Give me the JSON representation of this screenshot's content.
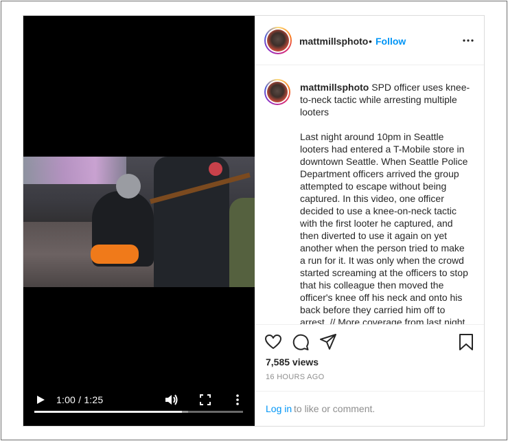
{
  "video": {
    "time_display": "1:00 / 1:25",
    "progress_fraction": 0.706,
    "buffered_fraction": 0.737
  },
  "header": {
    "username": "mattmillsphoto",
    "separator": "•",
    "follow_label": "Follow"
  },
  "caption": {
    "username": "mattmillsphoto",
    "title": "SPD officer uses knee-to-neck tactic while arresting multiple looters",
    "body": "Last night around 10pm in Seattle looters had entered a T-Mobile store in downtown Seattle. When Seattle Police Department officers arrived the group attempted to escape without being captured. In this video, one officer decided to use a knee-on-neck tactic with the first looter he captured, and then diverted to use it again on yet another when the person tried to make a run for it. It was only when the crowd started screaming at the officers to stop that his colleague then moved the officer's knee off his neck and onto his back before they carried him off to arrest. // More coverage from last night can be seen on my stories."
  },
  "stats": {
    "views": "7,585 views",
    "time_ago": "16 HOURS AGO"
  },
  "login": {
    "link_label": "Log in",
    "rest_text": "to like or comment."
  },
  "icons": {
    "play": "play-icon",
    "volume": "volume-icon",
    "fullscreen": "fullscreen-icon",
    "video_more": "more-vertical-icon",
    "header_more": "more-horizontal-icon",
    "like": "heart-icon",
    "comment": "comment-icon",
    "share": "share-icon",
    "save": "bookmark-icon"
  },
  "colors": {
    "follow": "#0095f6",
    "secondary_text": "#8e8e8e",
    "border": "#dbdbdb"
  }
}
